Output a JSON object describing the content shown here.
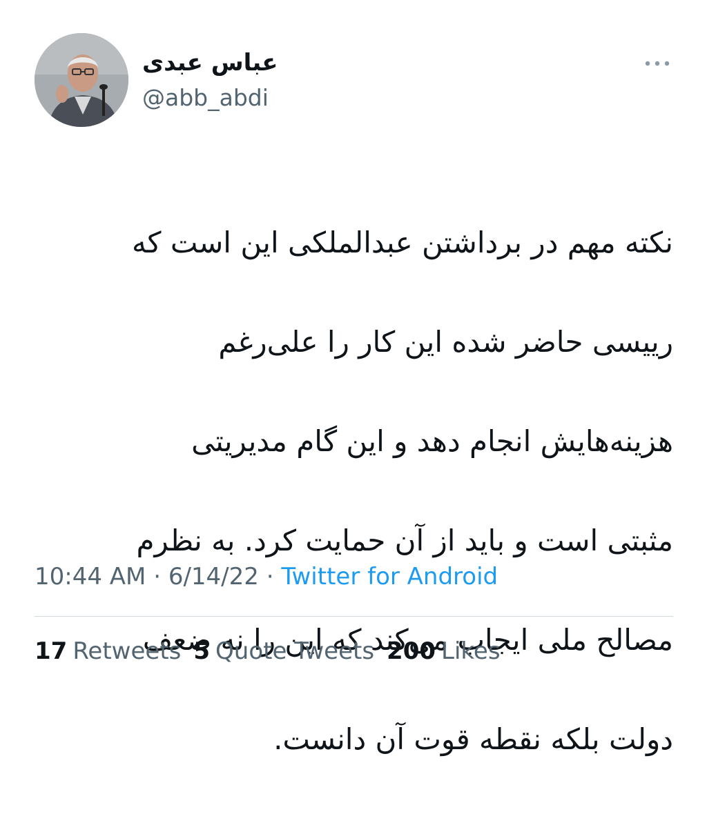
{
  "author": {
    "display_name": "عباس عبدی",
    "handle": "@abb_abdi",
    "avatar_icon": "profile-photo"
  },
  "more_icon": "ellipsis-horizontal-icon",
  "tweet": {
    "text_lines": [
      "نکته مهم در برداشتن عبدالملکی این است که",
      "رییسی حاضر شده این کار را علی‌رغم",
      "هزینه‌هایش انجام دهد و این گام مدیریتی",
      "مثبتی است و باید از آن حمایت کرد. به نظرم",
      "مصالح ملی ایجاب می‌کند که این را نه ضعف",
      "دولت بلکه نقطه قوت آن دانست."
    ]
  },
  "meta": {
    "time": "10:44 AM",
    "separator": " · ",
    "date": "6/14/22",
    "source": "Twitter for Android"
  },
  "stats": {
    "retweets_count": "17",
    "retweets_label": "Retweets",
    "quotes_count": "5",
    "quotes_label": "Quote Tweets",
    "likes_count": "200",
    "likes_label": "Likes"
  },
  "colors": {
    "text": "#0f1419",
    "secondary": "#536471",
    "link": "#1d9bf0",
    "divider": "#cfd9de"
  }
}
